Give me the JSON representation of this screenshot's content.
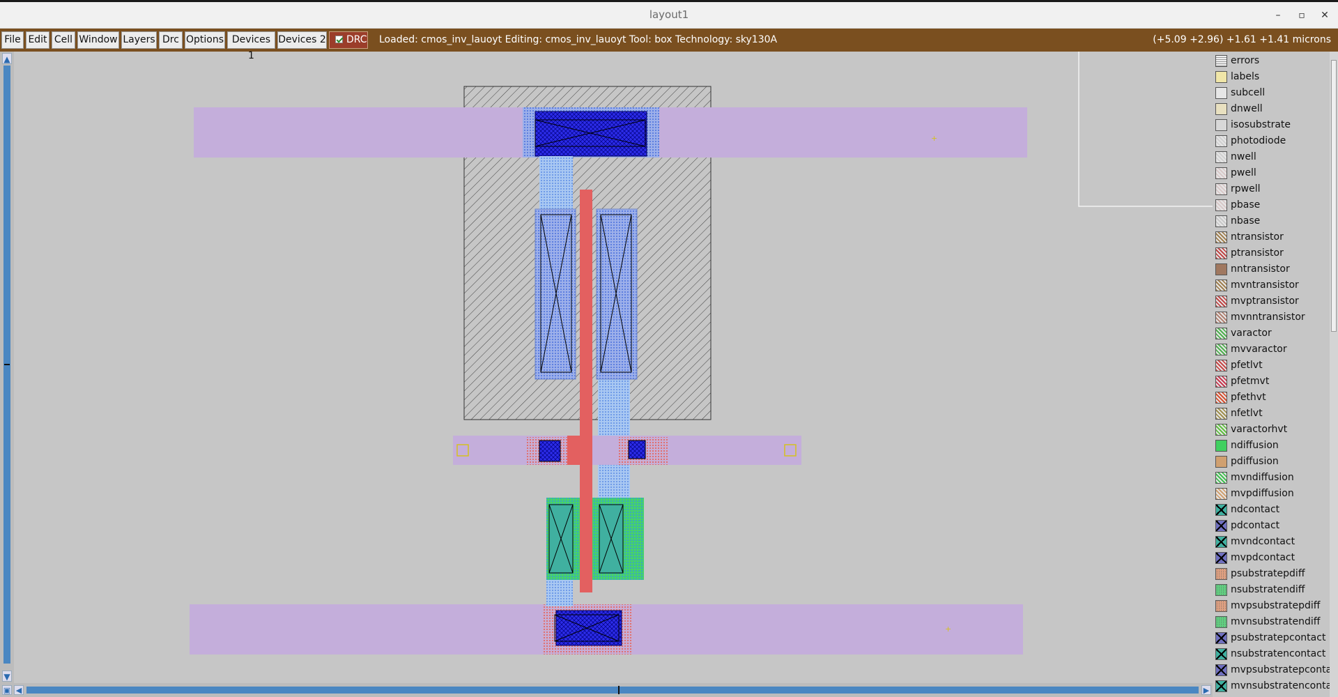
{
  "window": {
    "title": "layout1",
    "controls": {
      "minimize": "–",
      "restore": "▫",
      "close": "✕"
    }
  },
  "menubar": {
    "menus": [
      "File",
      "Edit",
      "Cell",
      "Window",
      "Layers",
      "Drc",
      "Options",
      "Devices 1",
      "Devices 2"
    ],
    "drc_label": "DRC",
    "drc_checked": true,
    "status": "Loaded: cmos_inv_lauoyt Editing: cmos_inv_lauoyt Tool: box  Technology: sky130A",
    "coords": "(+5.09 +2.96) +1.61 +1.41 microns"
  },
  "colors": {
    "menubar_bg": "#7a4f1f",
    "drc_bg": "#9b3d2a",
    "canvas_bg": "#c6c6c6",
    "metal1": "#c4aedb",
    "poly": "#e36060",
    "li_contact": "#2424e0",
    "ndiff": "#3fcf6a",
    "scrollbar": "#4a87c2"
  },
  "layers": [
    {
      "name": "errors",
      "color": "#e0e0e0",
      "icon": "grid-pattern-icon"
    },
    {
      "name": "labels",
      "color": "#f0e6a8",
      "icon": "solid-icon"
    },
    {
      "name": "subcell",
      "color": "#dcdcdc",
      "icon": "outline-icon"
    },
    {
      "name": "dnwell",
      "color": "#e8e0c0",
      "icon": "solid-icon"
    },
    {
      "name": "isosubstrate",
      "color": "#d8d8d8",
      "icon": "solid-icon"
    },
    {
      "name": "photodiode",
      "color": "#d0d0d0",
      "icon": "hatch-icon"
    },
    {
      "name": "nwell",
      "color": "#d0d0d0",
      "icon": "hatch-icon"
    },
    {
      "name": "pwell",
      "color": "#d8c8c8",
      "icon": "hatch-icon"
    },
    {
      "name": "rpwell",
      "color": "#d8c8c8",
      "icon": "hatch-icon"
    },
    {
      "name": "pbase",
      "color": "#d8c8c8",
      "icon": "hatch-icon"
    },
    {
      "name": "nbase",
      "color": "#c8c8c8",
      "icon": "hatch-icon"
    },
    {
      "name": "ntransistor",
      "color": "#a08050",
      "icon": "hatch-icon"
    },
    {
      "name": "ptransistor",
      "color": "#c04848",
      "icon": "hatch-icon"
    },
    {
      "name": "nntransistor",
      "color": "#a07860",
      "icon": "solid-icon"
    },
    {
      "name": "mvntransistor",
      "color": "#a08050",
      "icon": "hatch-icon"
    },
    {
      "name": "mvptransistor",
      "color": "#c04848",
      "icon": "hatch-icon"
    },
    {
      "name": "mvnntransistor",
      "color": "#b08070",
      "icon": "hatch-icon"
    },
    {
      "name": "varactor",
      "color": "#50b050",
      "icon": "hatch-icon"
    },
    {
      "name": "mvvaractor",
      "color": "#50b050",
      "icon": "hatch-icon"
    },
    {
      "name": "pfetlvt",
      "color": "#c84848",
      "icon": "hatch-icon"
    },
    {
      "name": "pfetmvt",
      "color": "#c83850",
      "icon": "hatch-icon"
    },
    {
      "name": "pfethvt",
      "color": "#d85030",
      "icon": "hatch-icon"
    },
    {
      "name": "nfetlvt",
      "color": "#a09050",
      "icon": "hatch-icon"
    },
    {
      "name": "varactorhvt",
      "color": "#60c040",
      "icon": "hatch-icon"
    },
    {
      "name": "ndiffusion",
      "color": "#40d060",
      "icon": "solid-icon"
    },
    {
      "name": "pdiffusion",
      "color": "#d0a070",
      "icon": "solid-icon"
    },
    {
      "name": "mvndiffusion",
      "color": "#40c050",
      "icon": "hatch-icon"
    },
    {
      "name": "mvpdiffusion",
      "color": "#d0a070",
      "icon": "hatch-icon"
    },
    {
      "name": "ndcontact",
      "color": "#40b0a0",
      "icon": "contact-icon"
    },
    {
      "name": "pdcontact",
      "color": "#7070c0",
      "icon": "contact-icon"
    },
    {
      "name": "mvndcontact",
      "color": "#40b0a0",
      "icon": "contact-icon"
    },
    {
      "name": "mvpdcontact",
      "color": "#7070c0",
      "icon": "contact-icon"
    },
    {
      "name": "psubstratepdiff",
      "color": "#e0a080",
      "icon": "dots-icon"
    },
    {
      "name": "nsubstratendiff",
      "color": "#60d080",
      "icon": "dots-icon"
    },
    {
      "name": "mvpsubstratepdiff",
      "color": "#e0a080",
      "icon": "dots-icon"
    },
    {
      "name": "mvnsubstratendiff",
      "color": "#60d080",
      "icon": "dots-icon"
    },
    {
      "name": "psubstratepcontact",
      "color": "#7070c0",
      "icon": "contact-icon"
    },
    {
      "name": "nsubstratencontact",
      "color": "#40b0a0",
      "icon": "contact-icon"
    },
    {
      "name": "mvpsubstratepcontact",
      "color": "#7070c0",
      "icon": "contact-icon"
    },
    {
      "name": "mvnsubstratencontact",
      "color": "#40b0a0",
      "icon": "contact-icon"
    }
  ]
}
